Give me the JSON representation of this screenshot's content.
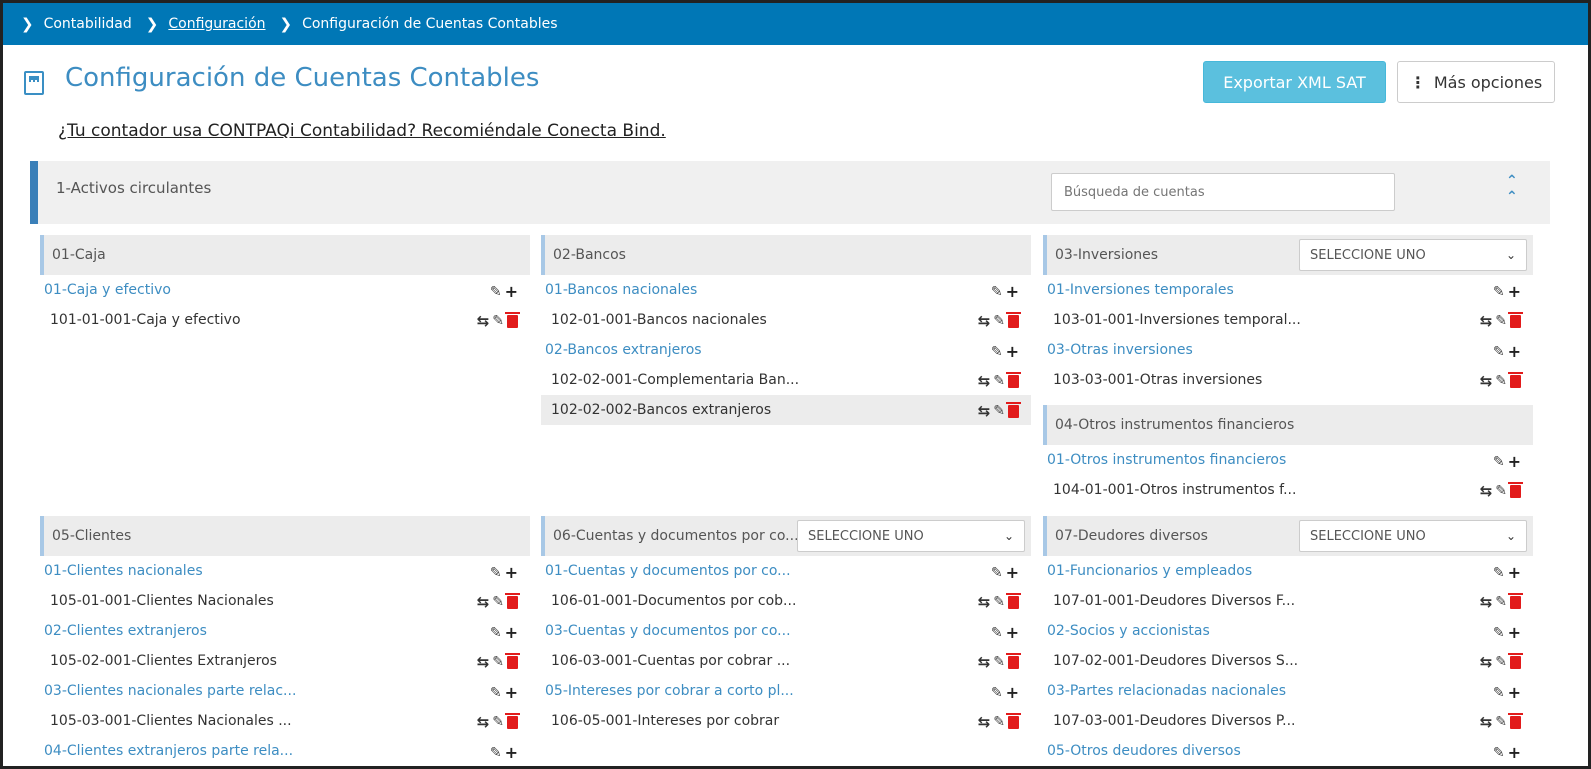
{
  "breadcrumb": {
    "items": [
      "Contabilidad",
      "Configuración",
      "Configuración de Cuentas Contables"
    ]
  },
  "header": {
    "title": "Configuración de Cuentas Contables",
    "cta": "¿Tu contador usa CONTPAQi Contabilidad? Recomiéndale Conecta Bind.",
    "export_label": "Exportar XML SAT",
    "more_label": "Más opciones"
  },
  "section": {
    "title": "1-Activos circulantes",
    "search_placeholder": "Búsqueda de cuentas"
  },
  "groups": {
    "caja": {
      "title": "01-Caja",
      "sub1": "01-Caja y efectivo",
      "acct1": "101-01-001-Caja y efectivo"
    },
    "bancos": {
      "title": "02-Bancos",
      "sub1": "01-Bancos nacionales",
      "acct1": "102-01-001-Bancos nacionales",
      "sub2": "02-Bancos extranjeros",
      "acct2": "102-02-001-Complementaria Ban...",
      "acct3": "102-02-002-Bancos extranjeros"
    },
    "inversiones": {
      "title": "03-Inversiones",
      "select": "SELECCIONE UNO",
      "sub1": "01-Inversiones temporales",
      "acct1": "103-01-001-Inversiones temporal...",
      "sub2": "03-Otras inversiones",
      "acct2": "103-03-001-Otras inversiones"
    },
    "otros_instr": {
      "title": "04-Otros instrumentos financieros",
      "sub1": "01-Otros instrumentos financieros",
      "acct1": "104-01-001-Otros instrumentos f..."
    },
    "clientes": {
      "title": "05-Clientes",
      "sub1": "01-Clientes nacionales",
      "acct1": "105-01-001-Clientes Nacionales",
      "sub2": "02-Clientes extranjeros",
      "acct2": "105-02-001-Clientes Extranjeros",
      "sub3": "03-Clientes nacionales parte relac...",
      "acct3": "105-03-001-Clientes Nacionales ...",
      "sub4": "04-Clientes extranjeros parte rela..."
    },
    "cuentas_docs": {
      "title": "06-Cuentas y documentos por co...",
      "select": "SELECCIONE UNO",
      "sub1": "01-Cuentas y documentos por co...",
      "acct1": "106-01-001-Documentos por cob...",
      "sub2": "03-Cuentas y documentos por co...",
      "acct2": "106-03-001-Cuentas por cobrar ...",
      "sub3": "05-Intereses por cobrar a corto pl...",
      "acct3": "106-05-001-Intereses por cobrar"
    },
    "deudores": {
      "title": "07-Deudores diversos",
      "select": "SELECCIONE UNO",
      "sub1": "01-Funcionarios y empleados",
      "acct1": "107-01-001-Deudores Diversos F...",
      "sub2": "02-Socios y accionistas",
      "acct2": "107-02-001-Deudores Diversos S...",
      "sub3": "03-Partes relacionadas nacionales",
      "acct3": "107-03-001-Deudores Diversos P...",
      "sub4": "05-Otros deudores diversos"
    }
  },
  "colors": {
    "breadcrumb_bg": "#0077b6",
    "accent_blue": "#3d8dc2",
    "export_btn": "#5bc0de",
    "delete_red": "#e21b1b"
  }
}
